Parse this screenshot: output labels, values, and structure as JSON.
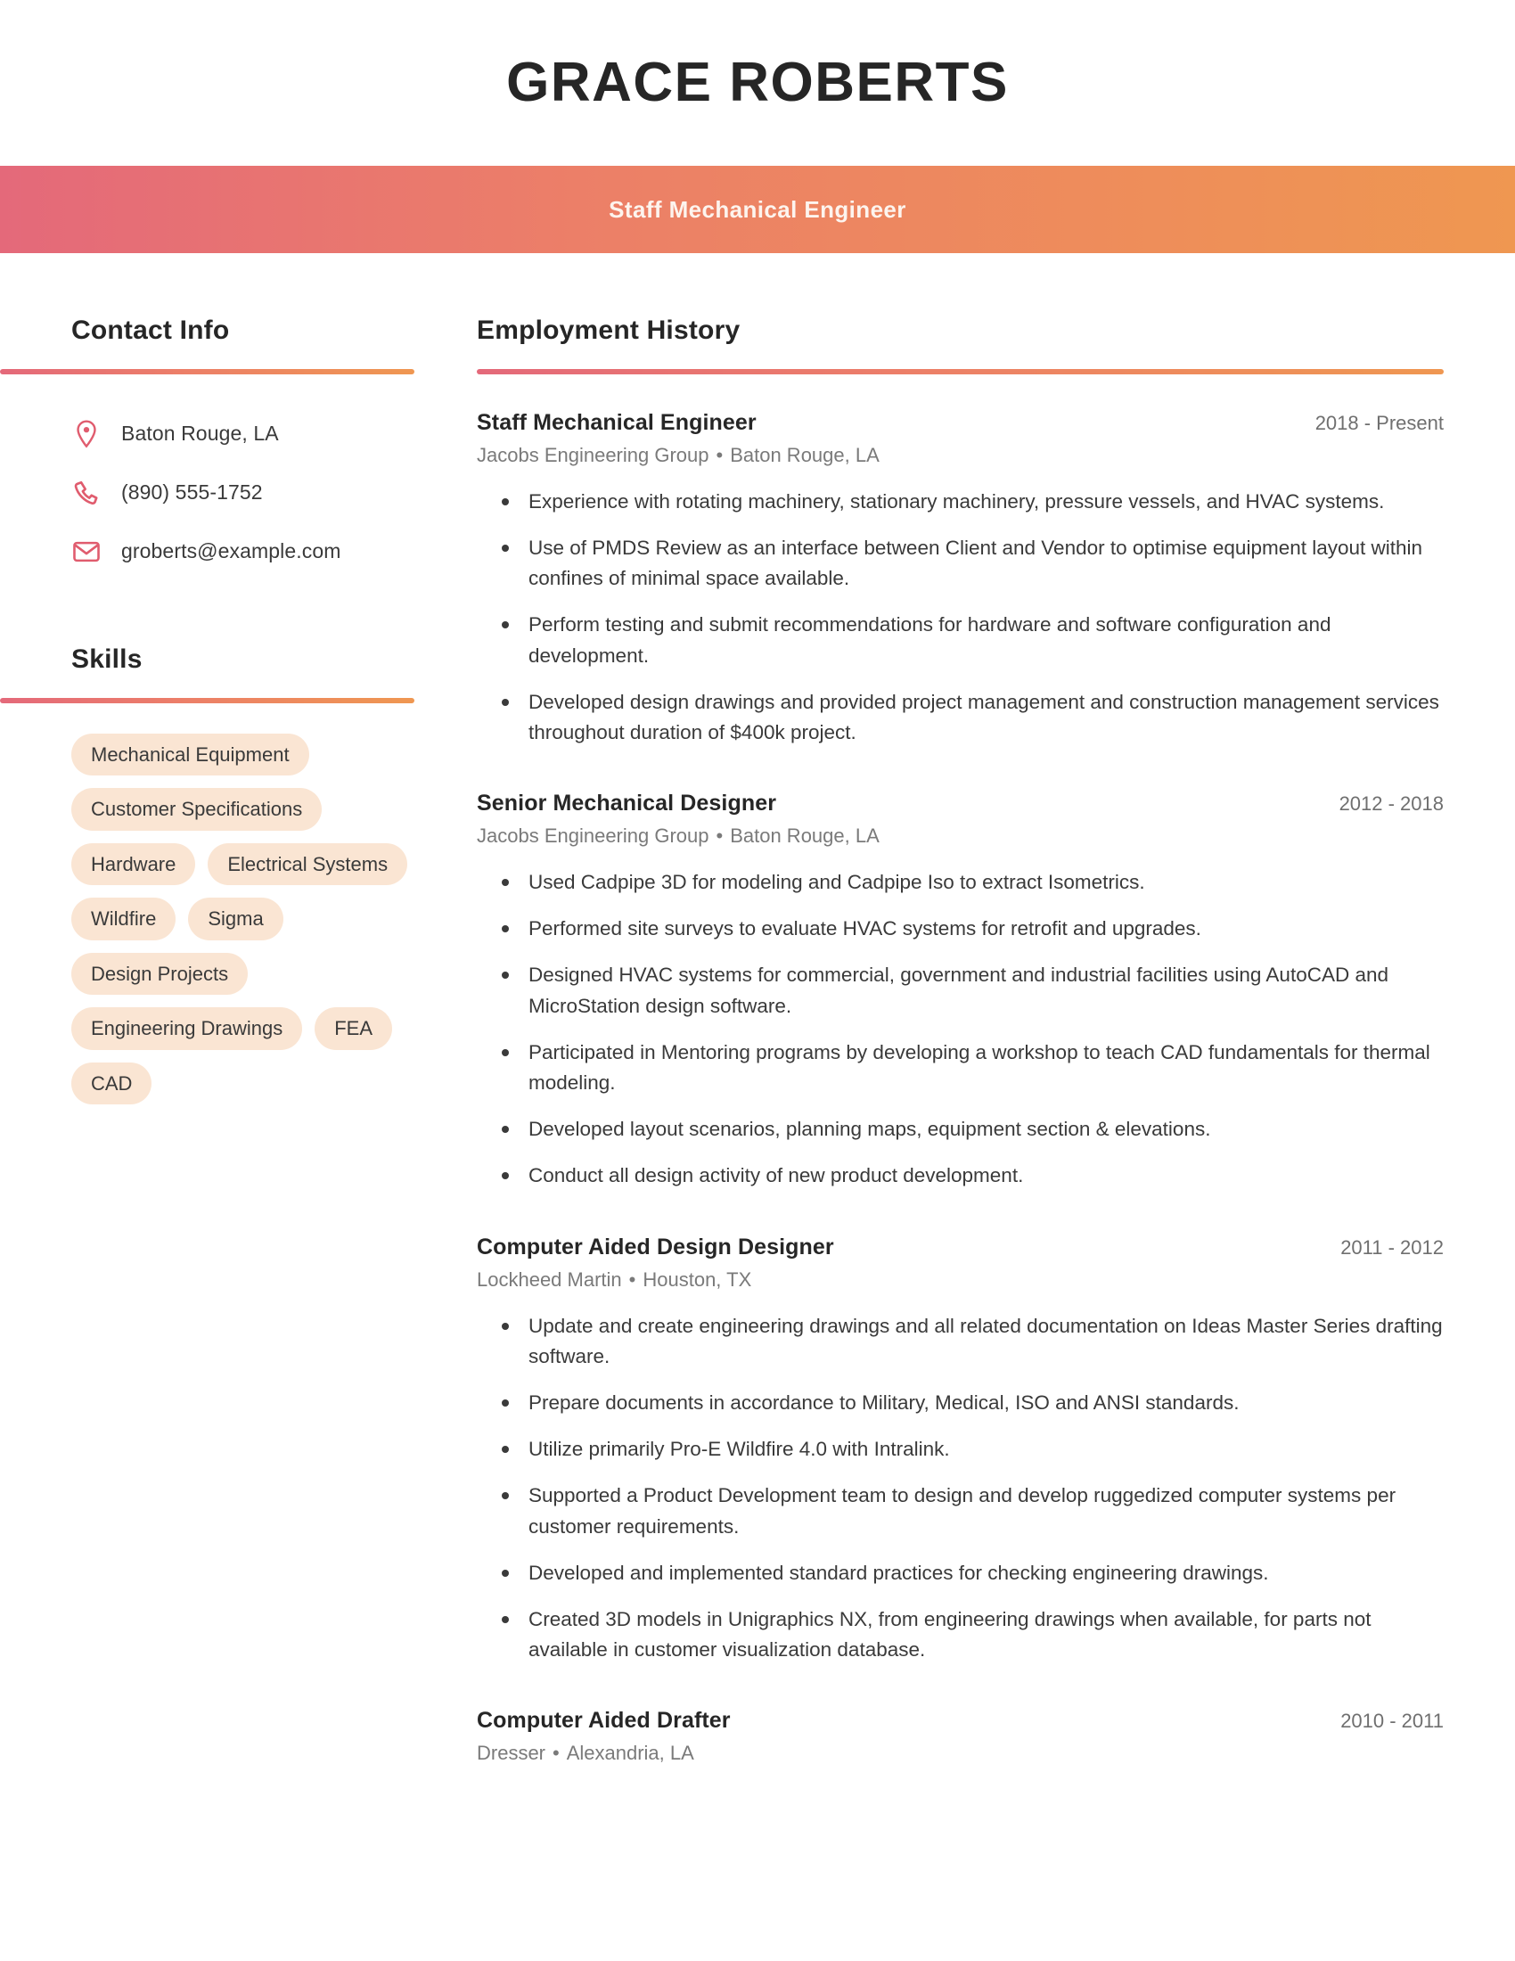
{
  "header": {
    "name": "GRACE ROBERTS",
    "title": "Staff Mechanical Engineer",
    "gradient_start": "#e4697a",
    "gradient_end": "#ef9751"
  },
  "sidebar": {
    "contact": {
      "heading": "Contact Info",
      "items": [
        {
          "icon": "location-pin-icon",
          "text": "Baton Rouge, LA"
        },
        {
          "icon": "phone-icon",
          "text": "(890) 555-1752"
        },
        {
          "icon": "envelope-icon",
          "text": "groberts@example.com"
        }
      ]
    },
    "skills": {
      "heading": "Skills",
      "chip_color": "#fae5d3",
      "items": [
        "Mechanical Equipment",
        "Customer Specifications",
        "Hardware",
        "Electrical Systems",
        "Wildfire",
        "Sigma",
        "Design Projects",
        "Engineering Drawings",
        "FEA",
        "CAD"
      ]
    }
  },
  "main": {
    "heading": "Employment History",
    "jobs": [
      {
        "title": "Staff Mechanical Engineer",
        "dates": "2018 - Present",
        "company": "Jacobs Engineering Group",
        "location": "Baton Rouge, LA",
        "bullets": [
          "Experience with rotating machinery, stationary machinery, pressure vessels, and HVAC systems.",
          "Use of PMDS Review as an interface between Client and Vendor to optimise equipment layout within confines of minimal space available.",
          "Perform testing and submit recommendations for hardware and software configuration and development.",
          "Developed design drawings and provided project management and construction management services throughout duration of $400k project."
        ]
      },
      {
        "title": "Senior Mechanical Designer",
        "dates": "2012 - 2018",
        "company": "Jacobs Engineering Group",
        "location": "Baton Rouge, LA",
        "bullets": [
          "Used Cadpipe 3D for modeling and Cadpipe Iso to extract Isometrics.",
          "Performed site surveys to evaluate HVAC systems for retrofit and upgrades.",
          "Designed HVAC systems for commercial, government and industrial facilities using AutoCAD and MicroStation design software.",
          "Participated in Mentoring programs by developing a workshop to teach CAD fundamentals for thermal modeling.",
          "Developed layout scenarios, planning maps, equipment section & elevations.",
          "Conduct all design activity of new product development."
        ]
      },
      {
        "title": "Computer Aided Design Designer",
        "dates": "2011 - 2012",
        "company": "Lockheed Martin",
        "location": "Houston, TX",
        "bullets": [
          "Update and create engineering drawings and all related documentation on Ideas Master Series drafting software.",
          "Prepare documents in accordance to Military, Medical, ISO and ANSI standards.",
          "Utilize primarily Pro-E Wildfire 4.0 with Intralink.",
          "Supported a Product Development team to design and develop ruggedized computer systems per customer requirements.",
          "Developed and implemented standard practices for checking engineering drawings.",
          "Created 3D models in Unigraphics NX, from engineering drawings when available, for parts not available in customer visualization database."
        ]
      },
      {
        "title": "Computer Aided Drafter",
        "dates": "2010 - 2011",
        "company": "Dresser",
        "location": "Alexandria, LA",
        "bullets": []
      }
    ]
  }
}
